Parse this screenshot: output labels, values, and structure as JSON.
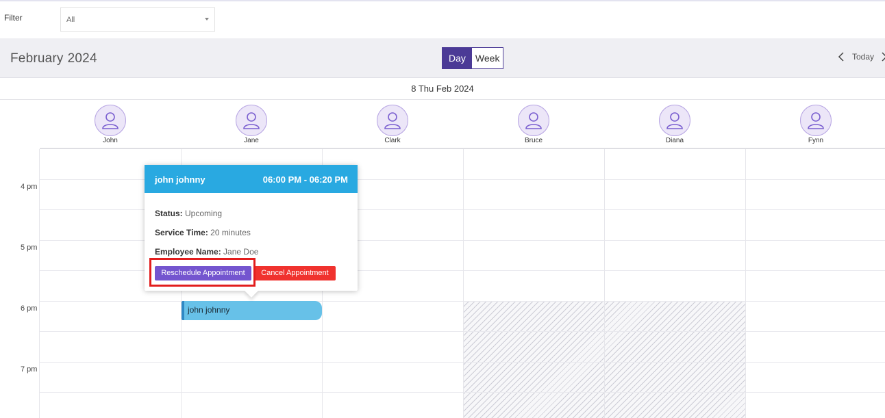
{
  "filter": {
    "label": "Filter",
    "selected": "All"
  },
  "toolbar": {
    "month": "February",
    "year": "2024",
    "views": {
      "day": "Day",
      "week": "Week",
      "active": "Day"
    },
    "today": "Today"
  },
  "date_header": "8 Thu Feb 2024",
  "resources": [
    "John",
    "Jane",
    "Clark",
    "Bruce",
    "Diana",
    "Fynn"
  ],
  "time_labels": [
    "4 pm",
    "5 pm",
    "6 pm",
    "7 pm"
  ],
  "event": {
    "title": "john johnny"
  },
  "popup": {
    "title": "john johnny",
    "time": "06:00 PM - 06:20 PM",
    "status_label": "Status:",
    "status_value": "Upcoming",
    "service_label": "Service Time:",
    "service_value": "20 minutes",
    "employee_label": "Employee Name:",
    "employee_value": "Jane Doe",
    "reschedule": "Reschedule Appointment",
    "cancel": "Cancel Appointment"
  },
  "colors": {
    "accent": "#4b3a96",
    "popup_header": "#29a9e1",
    "event": "#67c1e8",
    "reschedule": "#7455cf",
    "cancel": "#f0322e",
    "highlight": "#e21d1d"
  },
  "icons": {
    "filter_caret": "chevron-down-icon",
    "prev": "chevron-left-icon",
    "next": "chevron-right-icon",
    "avatar": "user-icon"
  }
}
